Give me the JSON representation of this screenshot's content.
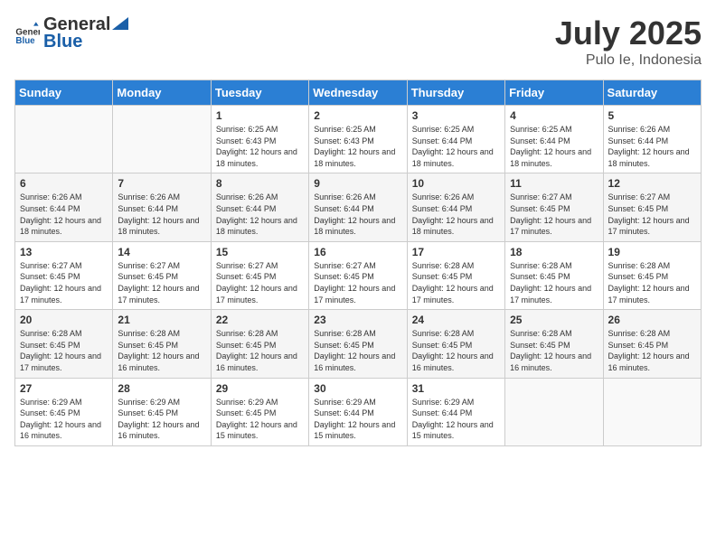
{
  "header": {
    "logo_general": "General",
    "logo_blue": "Blue",
    "title": "July 2025",
    "subtitle": "Pulo Ie, Indonesia"
  },
  "weekdays": [
    "Sunday",
    "Monday",
    "Tuesday",
    "Wednesday",
    "Thursday",
    "Friday",
    "Saturday"
  ],
  "weeks": [
    [
      {
        "day": "",
        "info": ""
      },
      {
        "day": "",
        "info": ""
      },
      {
        "day": "1",
        "info": "Sunrise: 6:25 AM\nSunset: 6:43 PM\nDaylight: 12 hours and 18 minutes."
      },
      {
        "day": "2",
        "info": "Sunrise: 6:25 AM\nSunset: 6:43 PM\nDaylight: 12 hours and 18 minutes."
      },
      {
        "day": "3",
        "info": "Sunrise: 6:25 AM\nSunset: 6:44 PM\nDaylight: 12 hours and 18 minutes."
      },
      {
        "day": "4",
        "info": "Sunrise: 6:25 AM\nSunset: 6:44 PM\nDaylight: 12 hours and 18 minutes."
      },
      {
        "day": "5",
        "info": "Sunrise: 6:26 AM\nSunset: 6:44 PM\nDaylight: 12 hours and 18 minutes."
      }
    ],
    [
      {
        "day": "6",
        "info": "Sunrise: 6:26 AM\nSunset: 6:44 PM\nDaylight: 12 hours and 18 minutes."
      },
      {
        "day": "7",
        "info": "Sunrise: 6:26 AM\nSunset: 6:44 PM\nDaylight: 12 hours and 18 minutes."
      },
      {
        "day": "8",
        "info": "Sunrise: 6:26 AM\nSunset: 6:44 PM\nDaylight: 12 hours and 18 minutes."
      },
      {
        "day": "9",
        "info": "Sunrise: 6:26 AM\nSunset: 6:44 PM\nDaylight: 12 hours and 18 minutes."
      },
      {
        "day": "10",
        "info": "Sunrise: 6:26 AM\nSunset: 6:44 PM\nDaylight: 12 hours and 18 minutes."
      },
      {
        "day": "11",
        "info": "Sunrise: 6:27 AM\nSunset: 6:45 PM\nDaylight: 12 hours and 17 minutes."
      },
      {
        "day": "12",
        "info": "Sunrise: 6:27 AM\nSunset: 6:45 PM\nDaylight: 12 hours and 17 minutes."
      }
    ],
    [
      {
        "day": "13",
        "info": "Sunrise: 6:27 AM\nSunset: 6:45 PM\nDaylight: 12 hours and 17 minutes."
      },
      {
        "day": "14",
        "info": "Sunrise: 6:27 AM\nSunset: 6:45 PM\nDaylight: 12 hours and 17 minutes."
      },
      {
        "day": "15",
        "info": "Sunrise: 6:27 AM\nSunset: 6:45 PM\nDaylight: 12 hours and 17 minutes."
      },
      {
        "day": "16",
        "info": "Sunrise: 6:27 AM\nSunset: 6:45 PM\nDaylight: 12 hours and 17 minutes."
      },
      {
        "day": "17",
        "info": "Sunrise: 6:28 AM\nSunset: 6:45 PM\nDaylight: 12 hours and 17 minutes."
      },
      {
        "day": "18",
        "info": "Sunrise: 6:28 AM\nSunset: 6:45 PM\nDaylight: 12 hours and 17 minutes."
      },
      {
        "day": "19",
        "info": "Sunrise: 6:28 AM\nSunset: 6:45 PM\nDaylight: 12 hours and 17 minutes."
      }
    ],
    [
      {
        "day": "20",
        "info": "Sunrise: 6:28 AM\nSunset: 6:45 PM\nDaylight: 12 hours and 17 minutes."
      },
      {
        "day": "21",
        "info": "Sunrise: 6:28 AM\nSunset: 6:45 PM\nDaylight: 12 hours and 16 minutes."
      },
      {
        "day": "22",
        "info": "Sunrise: 6:28 AM\nSunset: 6:45 PM\nDaylight: 12 hours and 16 minutes."
      },
      {
        "day": "23",
        "info": "Sunrise: 6:28 AM\nSunset: 6:45 PM\nDaylight: 12 hours and 16 minutes."
      },
      {
        "day": "24",
        "info": "Sunrise: 6:28 AM\nSunset: 6:45 PM\nDaylight: 12 hours and 16 minutes."
      },
      {
        "day": "25",
        "info": "Sunrise: 6:28 AM\nSunset: 6:45 PM\nDaylight: 12 hours and 16 minutes."
      },
      {
        "day": "26",
        "info": "Sunrise: 6:28 AM\nSunset: 6:45 PM\nDaylight: 12 hours and 16 minutes."
      }
    ],
    [
      {
        "day": "27",
        "info": "Sunrise: 6:29 AM\nSunset: 6:45 PM\nDaylight: 12 hours and 16 minutes."
      },
      {
        "day": "28",
        "info": "Sunrise: 6:29 AM\nSunset: 6:45 PM\nDaylight: 12 hours and 16 minutes."
      },
      {
        "day": "29",
        "info": "Sunrise: 6:29 AM\nSunset: 6:45 PM\nDaylight: 12 hours and 15 minutes."
      },
      {
        "day": "30",
        "info": "Sunrise: 6:29 AM\nSunset: 6:44 PM\nDaylight: 12 hours and 15 minutes."
      },
      {
        "day": "31",
        "info": "Sunrise: 6:29 AM\nSunset: 6:44 PM\nDaylight: 12 hours and 15 minutes."
      },
      {
        "day": "",
        "info": ""
      },
      {
        "day": "",
        "info": ""
      }
    ]
  ]
}
